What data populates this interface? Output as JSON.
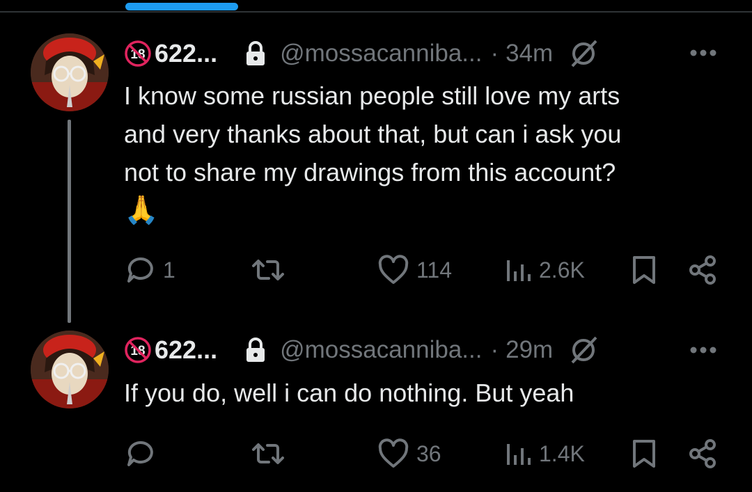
{
  "tweets": [
    {
      "display_name": "622...",
      "handle": "@mossacanniba...",
      "separator": "·",
      "time": "34m",
      "text_lines": [
        "I know some russian people still love my arts",
        "and very thanks about that, but can i ask you",
        "not to share my drawings from this account?"
      ],
      "emoji": "🙏",
      "replies": "1",
      "retweets": "",
      "likes": "114",
      "views": "2.6K"
    },
    {
      "display_name": "622...",
      "handle": "@mossacanniba...",
      "separator": "·",
      "time": "29m",
      "text_lines": [
        "If you do, well i can do nothing. But yeah"
      ],
      "emoji": "",
      "replies": "",
      "retweets": "",
      "likes": "36",
      "views": "1.4K"
    }
  ],
  "badge_text": "18",
  "colors": {
    "accent": "#1d9bf0",
    "muted": "#71767b",
    "text": "#e7e9ea",
    "badge": "#e0245e"
  },
  "icons": [
    "no-18-badge-icon",
    "lock-icon",
    "grok-icon",
    "more-icon",
    "reply-icon",
    "retweet-icon",
    "like-icon",
    "views-icon",
    "bookmark-icon",
    "share-icon"
  ]
}
